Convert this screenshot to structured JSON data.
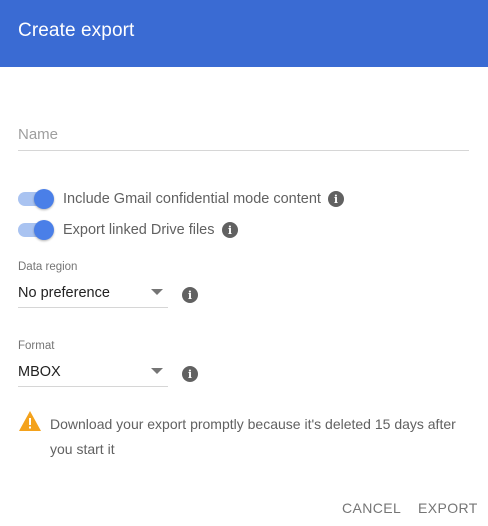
{
  "colors": {
    "accent": "#3a6bd3",
    "toggle_on": "#4a7fe8",
    "warning": "#f4a21c"
  },
  "dialog": {
    "title": "Create export"
  },
  "name_field": {
    "placeholder": "Name",
    "value": ""
  },
  "toggles": [
    {
      "label": "Include Gmail confidential mode content",
      "checked": true,
      "info_icon": "info-icon"
    },
    {
      "label": "Export linked Drive files",
      "checked": true,
      "info_icon": "info-icon"
    }
  ],
  "data_region": {
    "label": "Data region",
    "selected": "No preference",
    "info_icon": "info-icon"
  },
  "format": {
    "label": "Format",
    "selected": "MBOX",
    "info_icon": "info-icon"
  },
  "warning": {
    "icon": "warning-icon",
    "text": "Download your export promptly because it's deleted 15 days after you start it"
  },
  "actions": {
    "cancel": "CANCEL",
    "export": "EXPORT"
  }
}
